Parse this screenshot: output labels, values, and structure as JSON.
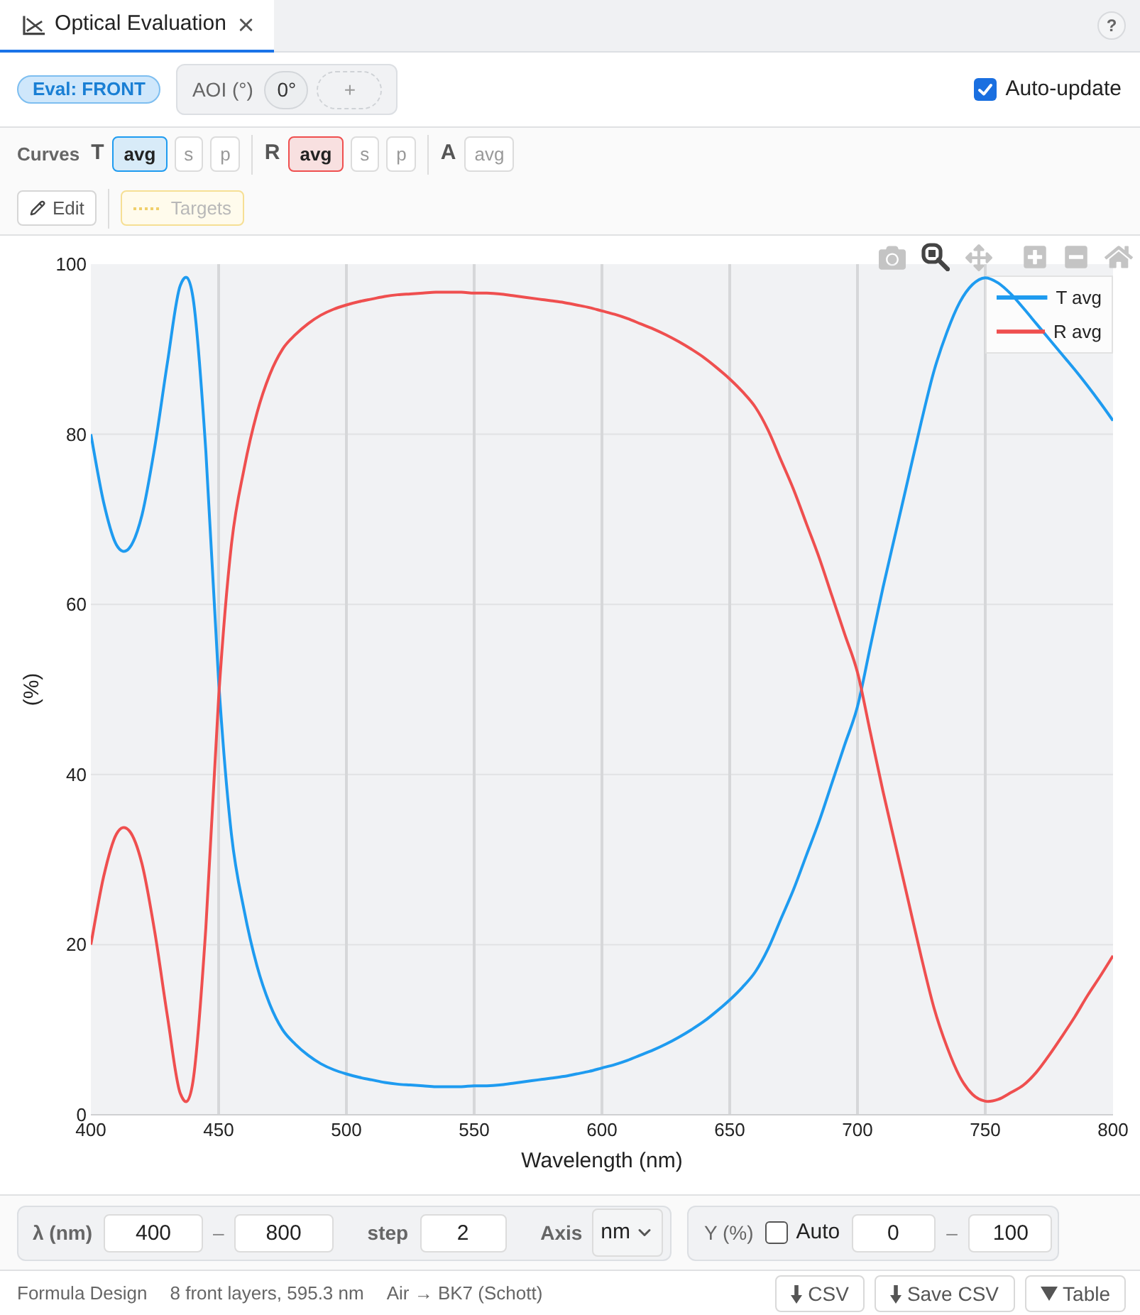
{
  "tabs": [
    {
      "label": "Optical Evaluation",
      "selected": true
    }
  ],
  "help_button": "?",
  "toolbar": {
    "eval_badge": "Eval: FRONT",
    "aoi": {
      "label": "AOI (°)",
      "angles": [
        "0°"
      ],
      "add": "+"
    },
    "auto_update": {
      "label": "Auto-update",
      "checked": true
    }
  },
  "curves": {
    "label": "Curves",
    "groups": [
      {
        "label": "T",
        "color": "#1e9bf0",
        "options": [
          {
            "label": "avg",
            "selected": true
          },
          {
            "label": "s",
            "selected": false
          },
          {
            "label": "p",
            "selected": false
          }
        ]
      },
      {
        "label": "R",
        "color": "#ef4f4f",
        "options": [
          {
            "label": "avg",
            "selected": true
          },
          {
            "label": "s",
            "selected": false
          },
          {
            "label": "p",
            "selected": false
          }
        ]
      },
      {
        "label": "A",
        "options": [
          {
            "label": "avg",
            "selected": false
          }
        ]
      }
    ],
    "edit": {
      "label": "Edit"
    },
    "targets": {
      "label": "Targets",
      "disabled": true
    }
  },
  "chart": {
    "modebar": [
      {
        "kind": "camera",
        "selected": false
      },
      {
        "kind": "zoom",
        "selected": true
      },
      {
        "kind": "pan",
        "selected": false
      },
      {
        "kind": "zoom_in",
        "selected": false
      },
      {
        "kind": "zoom_out",
        "selected": false
      },
      {
        "kind": "reset",
        "selected": false
      }
    ],
    "chart_data": {
      "type": "line",
      "xlabel": "Wavelength (nm)",
      "ylabel": "(%)",
      "xlim": [
        400,
        800
      ],
      "ylim": [
        0,
        100
      ],
      "xticks": [
        {
          "value": 400,
          "label": "400"
        },
        {
          "value": 450,
          "label": "450"
        },
        {
          "value": 500,
          "label": "500"
        },
        {
          "value": 550,
          "label": "550"
        },
        {
          "value": 600,
          "label": "600"
        },
        {
          "value": 650,
          "label": "650"
        },
        {
          "value": 700,
          "label": "700"
        },
        {
          "value": 750,
          "label": "750"
        },
        {
          "value": 800,
          "label": "800"
        }
      ],
      "yticks": [
        {
          "value": 0,
          "label": "0"
        },
        {
          "value": 20,
          "label": "20"
        },
        {
          "value": 40,
          "label": "40"
        },
        {
          "value": 60,
          "label": "60"
        },
        {
          "value": 80,
          "label": "80"
        },
        {
          "value": 100,
          "label": "100"
        }
      ],
      "grid": true,
      "legend": true,
      "x": [
        400,
        405,
        410,
        415,
        420,
        425,
        430,
        435,
        440,
        445,
        450,
        455,
        460,
        465,
        470,
        475,
        480,
        485,
        490,
        495,
        500,
        505,
        510,
        515,
        520,
        525,
        530,
        535,
        540,
        545,
        550,
        555,
        560,
        565,
        570,
        575,
        580,
        585,
        590,
        595,
        600,
        605,
        610,
        615,
        620,
        625,
        630,
        635,
        640,
        645,
        650,
        655,
        660,
        665,
        670,
        675,
        680,
        685,
        690,
        695,
        700,
        705,
        710,
        715,
        720,
        725,
        730,
        735,
        740,
        745,
        750,
        755,
        760,
        765,
        770,
        775,
        780,
        785,
        790,
        795,
        800
      ],
      "series": [
        {
          "name": "T avg",
          "color": "#1e9bf0",
          "values": [
            80.0,
            72.0,
            67.0,
            66.6,
            70.5,
            78.5,
            88.5,
            97.5,
            96.0,
            78.0,
            51.0,
            33.0,
            24.0,
            17.5,
            13.0,
            10.0,
            8.3,
            7.0,
            6.0,
            5.3,
            4.8,
            4.4,
            4.1,
            3.8,
            3.6,
            3.5,
            3.4,
            3.3,
            3.3,
            3.3,
            3.4,
            3.4,
            3.5,
            3.7,
            3.9,
            4.1,
            4.3,
            4.5,
            4.8,
            5.1,
            5.5,
            5.9,
            6.4,
            7.0,
            7.6,
            8.3,
            9.1,
            10.0,
            11.0,
            12.2,
            13.5,
            15.0,
            16.8,
            19.5,
            23.0,
            26.5,
            30.5,
            34.5,
            39.0,
            43.5,
            48.0,
            55.0,
            62.0,
            68.5,
            75.0,
            81.5,
            87.5,
            92.0,
            95.5,
            97.6,
            98.4,
            97.8,
            96.5,
            94.8,
            93.0,
            91.2,
            89.4,
            87.6,
            85.7,
            83.7,
            81.6
          ]
        },
        {
          "name": "R avg",
          "color": "#ef4f4f",
          "values": [
            20.0,
            28.0,
            33.0,
            33.4,
            29.5,
            21.5,
            11.5,
            2.5,
            4.0,
            22.0,
            49.0,
            67.0,
            76.0,
            82.5,
            87.0,
            90.0,
            91.7,
            93.0,
            94.0,
            94.7,
            95.2,
            95.6,
            95.9,
            96.2,
            96.4,
            96.5,
            96.6,
            96.7,
            96.7,
            96.7,
            96.6,
            96.6,
            96.5,
            96.3,
            96.1,
            95.9,
            95.7,
            95.5,
            95.2,
            94.9,
            94.5,
            94.1,
            93.6,
            93.0,
            92.4,
            91.7,
            90.9,
            90.0,
            89.0,
            87.8,
            86.5,
            85.0,
            83.2,
            80.5,
            77.0,
            73.5,
            69.5,
            65.5,
            61.0,
            56.5,
            52.0,
            45.0,
            38.0,
            31.5,
            25.0,
            18.5,
            12.5,
            8.0,
            4.5,
            2.4,
            1.6,
            1.8,
            2.6,
            3.5,
            5.0,
            7.0,
            9.2,
            11.5,
            14.0,
            16.3,
            18.7
          ]
        }
      ]
    }
  },
  "range": {
    "wavelength": {
      "label": "λ (nm)",
      "from": "400",
      "separator": "–",
      "to": "800",
      "step_label": "step",
      "step": "2",
      "axis_label": "Axis",
      "axis_unit": "nm"
    },
    "y": {
      "label": "Y (%)",
      "auto": {
        "label": "Auto",
        "checked": false
      },
      "min": "0",
      "separator": "–",
      "max": "100"
    }
  },
  "status_bar": {
    "items": [
      "Formula Design",
      "8 front layers, 595.3 nm",
      "Air → BK7 (Schott)"
    ],
    "buttons": [
      {
        "kind": "download",
        "label": "CSV"
      },
      {
        "kind": "download",
        "label": "Save CSV"
      },
      {
        "kind": "toggle",
        "label": "Table"
      }
    ]
  }
}
